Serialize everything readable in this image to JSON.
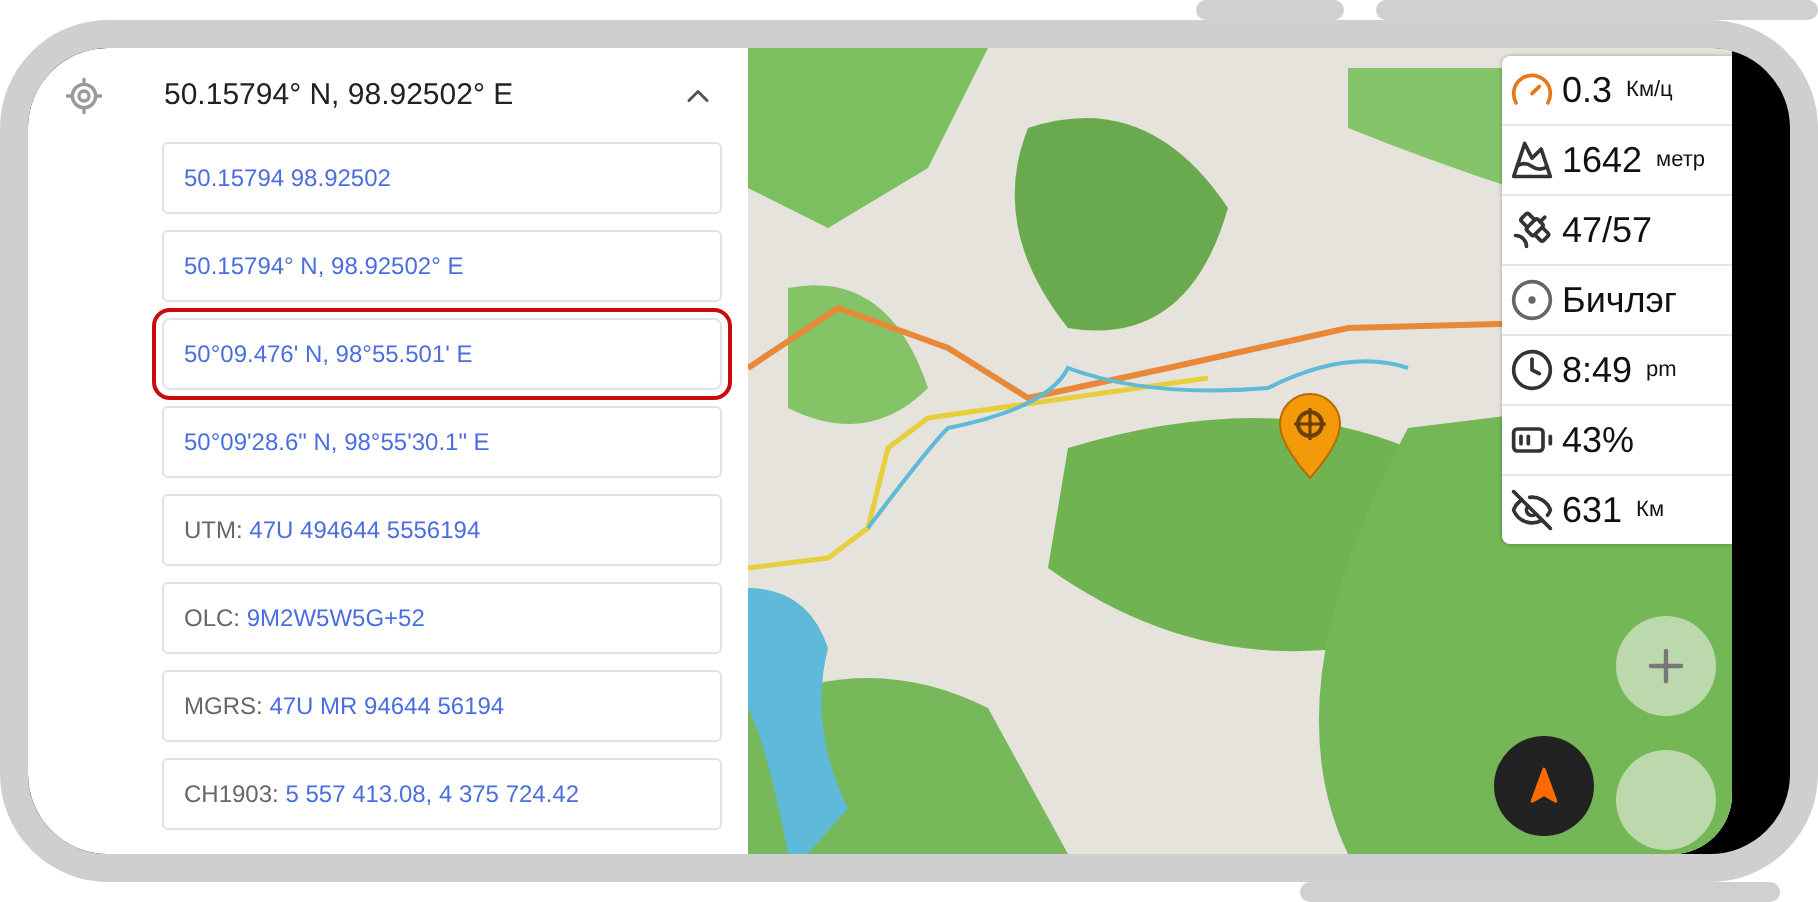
{
  "header": {
    "title": "50.15794° N, 98.92502° E",
    "expanded": true
  },
  "formats": [
    {
      "kind": "plain",
      "value": "50.15794 98.92502",
      "highlighted": false
    },
    {
      "kind": "plain",
      "value": "50.15794° N, 98.92502° E",
      "highlighted": false
    },
    {
      "kind": "plain",
      "value": "50°09.476' N, 98°55.501' E",
      "highlighted": true
    },
    {
      "kind": "plain",
      "value": "50°09'28.6\" N, 98°55'30.1\" E",
      "highlighted": false
    },
    {
      "kind": "labeled",
      "label": "UTM:",
      "value": "47U 494644 5556194",
      "highlighted": false
    },
    {
      "kind": "labeled",
      "label": "OLC:",
      "value": "9M2W5W5G+52",
      "highlighted": false
    },
    {
      "kind": "labeled",
      "label": "MGRS:",
      "value": "47U MR 94644 56194",
      "highlighted": false
    },
    {
      "kind": "labeled",
      "label": "CH1903:",
      "value": "5 557 413.08, 4 375 724.42",
      "highlighted": false
    }
  ],
  "widgets": [
    {
      "kind": "speed",
      "value": "0.3",
      "unit": "Км/ц"
    },
    {
      "kind": "altitude",
      "value": "1642",
      "unit": "метр"
    },
    {
      "kind": "satellites",
      "value": "47/57"
    },
    {
      "kind": "track",
      "value": "Бичлэг"
    },
    {
      "kind": "time",
      "value": "8:49",
      "unit": "pm"
    },
    {
      "kind": "battery",
      "value": "43%"
    },
    {
      "kind": "distance",
      "value": "631",
      "unit": "Км"
    }
  ]
}
